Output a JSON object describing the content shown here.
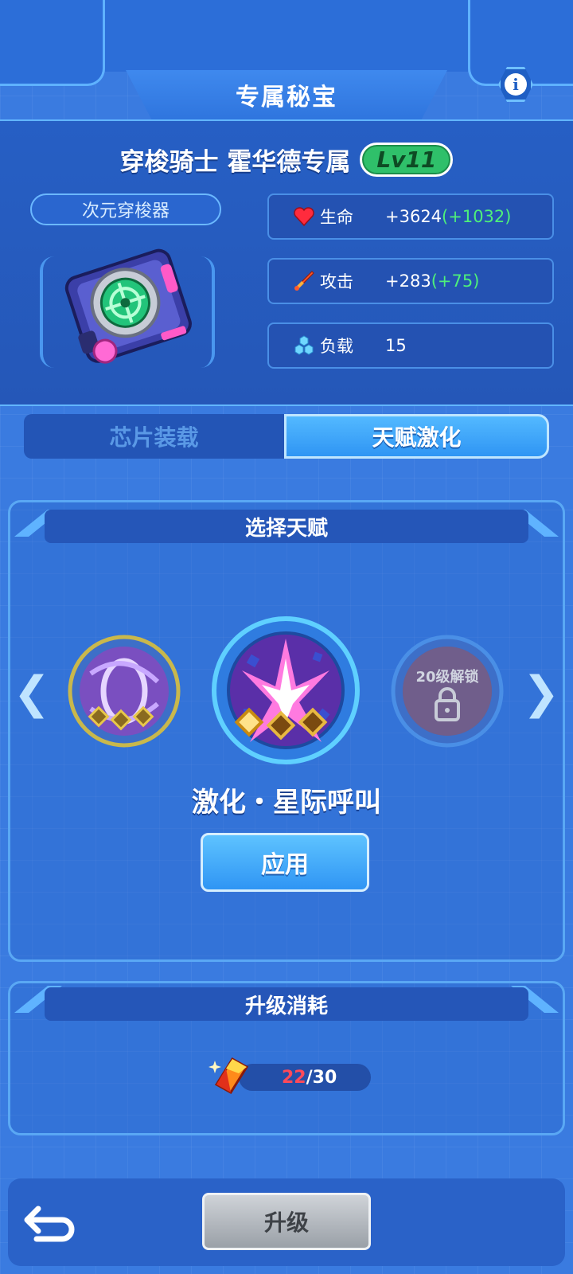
{
  "header": {
    "title": "专属秘宝",
    "info_icon": "info-icon",
    "info_symbol": "i"
  },
  "hero": {
    "name": "穿梭骑士 霍华德专属",
    "level": "Lv11",
    "item_type": "次元穿梭器",
    "item_icon": "dimension-shuttle-device-icon"
  },
  "stats": [
    {
      "icon": "heart-icon",
      "label": "生命",
      "value": "+3624",
      "bonus": "(+1032)"
    },
    {
      "icon": "sword-icon",
      "label": "攻击",
      "value": "+283",
      "bonus": "(+75)"
    },
    {
      "icon": "hexagons-icon",
      "label": "负载",
      "value": "15",
      "bonus": ""
    }
  ],
  "tabs": [
    {
      "label": "芯片装载",
      "active": false
    },
    {
      "label": "天赋激化",
      "active": true
    }
  ],
  "talent": {
    "header": "选择天赋",
    "prev_arrow": "❮",
    "next_arrow": "❯",
    "options": [
      {
        "name": "vortex-talent",
        "selected": false,
        "locked": false
      },
      {
        "name": "star-burst-talent",
        "selected": true,
        "locked": false
      },
      {
        "name": "locked-talent",
        "selected": false,
        "locked": true,
        "lock_text": "20级解锁"
      }
    ],
    "selected_name": "激化・星际呼叫",
    "apply_label": "应用"
  },
  "upgrade_cost": {
    "header": "升级消耗",
    "item_icon": "crystal-icon",
    "have": "22",
    "separator": "/",
    "need": "30"
  },
  "footer": {
    "back_icon": "back-arrow-icon",
    "upgrade_label": "升级"
  },
  "colors": {
    "bonus_green": "#4ef07a",
    "cost_red": "#ff4a5a",
    "accent_blue": "#2f95f4"
  }
}
